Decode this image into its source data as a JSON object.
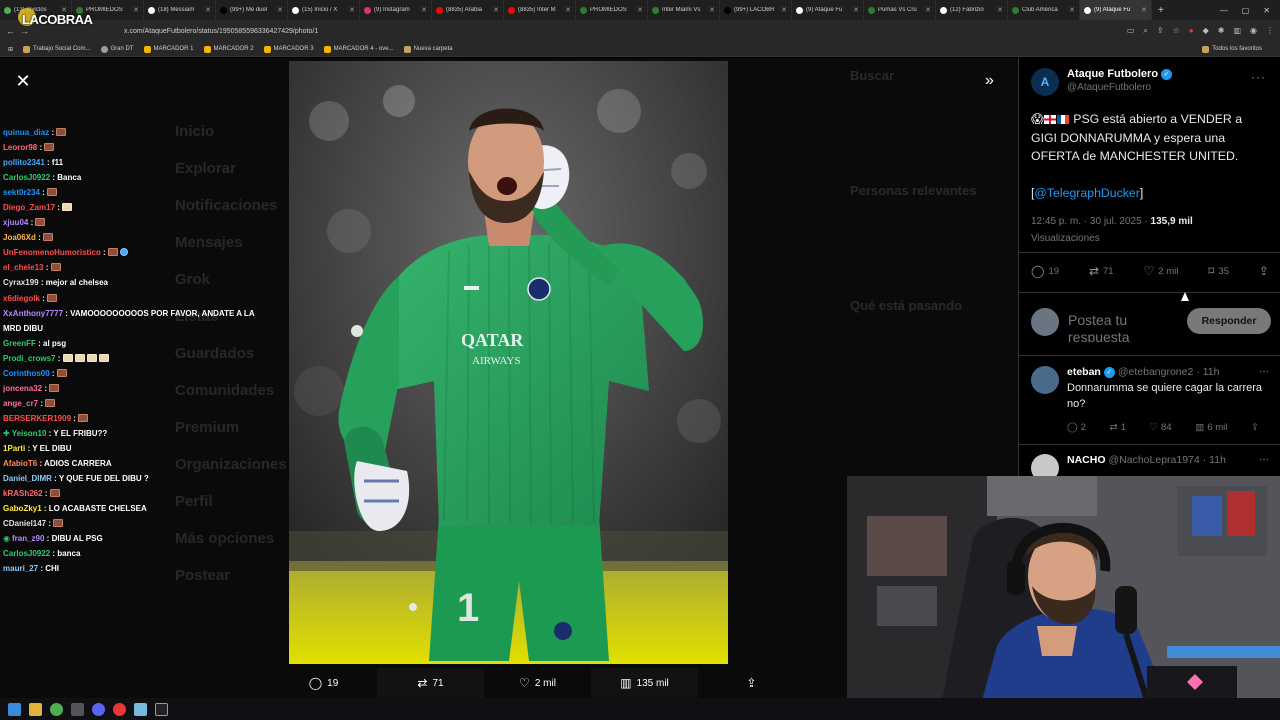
{
  "browser": {
    "tabs": [
      {
        "label": "(13) Invictos",
        "color": "#4caf50"
      },
      {
        "label": "PROMIEDOS",
        "color": "#2e7d32"
      },
      {
        "label": "(18) Messiam",
        "color": "#ffffff"
      },
      {
        "label": "(99+) Me duel",
        "color": "#000000"
      },
      {
        "label": "(15) Inicio / X",
        "color": "#ffffff"
      },
      {
        "label": "(9) Instagram",
        "color": "#e1306c"
      },
      {
        "label": "(8835) Arabia",
        "color": "#ff0000"
      },
      {
        "label": "(8835) Inter M",
        "color": "#ff0000"
      },
      {
        "label": "PROMIEDOS",
        "color": "#2e7d32"
      },
      {
        "label": "Inter Miami Vs",
        "color": "#2e7d32"
      },
      {
        "label": "(99+) LACOBR",
        "color": "#000000"
      },
      {
        "label": "(9) Ataque Fu",
        "color": "#ffffff"
      },
      {
        "label": "Pumas Vs Cru",
        "color": "#2e7d32"
      },
      {
        "label": "(12) Fabrizio",
        "color": "#ffffff"
      },
      {
        "label": "Club América",
        "color": "#2e7d32"
      },
      {
        "label": "(9) Ataque Fu",
        "color": "#ffffff",
        "active": true
      }
    ],
    "url": "x.com/AtaqueFutbolero/status/1950585596336427429/photo/1",
    "bookmarks": [
      {
        "label": "Trabajo Social Com...",
        "type": "folder"
      },
      {
        "label": "Gran DT",
        "type": "grey"
      },
      {
        "label": "MARCADOR 1",
        "type": "star"
      },
      {
        "label": "MARCADOR 2",
        "type": "star"
      },
      {
        "label": "MARCADOR 3",
        "type": "star"
      },
      {
        "label": "MARCADOR 4 - ove...",
        "type": "star"
      },
      {
        "label": "Nueva carpeta",
        "type": "folder"
      }
    ],
    "all_bookmarks_label": "Todos los favoritos"
  },
  "overlay": {
    "logo": "LACOBRAA"
  },
  "chat": [
    {
      "user": "quinua_diaz",
      "color": "#1e90ff",
      "msg": "",
      "emotes": [
        "brick"
      ]
    },
    {
      "user": "Leoror98",
      "color": "#ff6b6b",
      "msg": "",
      "emotes": [
        "brick"
      ]
    },
    {
      "user": "pollito2341",
      "color": "#3fa9ff",
      "msg": "f11",
      "emotes": []
    },
    {
      "user": "CarlosJ0922",
      "color": "#2ecc71",
      "msg": "Banca",
      "emotes": []
    },
    {
      "user": "sekt0r234",
      "color": "#1e90ff",
      "msg": "",
      "emotes": [
        "brick"
      ]
    },
    {
      "user": "Diego_Zam17",
      "color": "#ff4d4d",
      "msg": "",
      "emotes": [
        "brick-light"
      ]
    },
    {
      "user": "xjuu04",
      "color": "#b388ff",
      "msg": "",
      "emotes": [
        "brick"
      ]
    },
    {
      "user": "Joa06Xd",
      "color": "#ffb74d",
      "msg": "",
      "emotes": [
        "brick"
      ]
    },
    {
      "user": "UnFenomenoHumoristico",
      "color": "#ff4d4d",
      "msg": "",
      "emotes": [
        "brick",
        "bird"
      ]
    },
    {
      "user": "el_chele13",
      "color": "#ff4d4d",
      "msg": "",
      "emotes": [
        "brick"
      ]
    },
    {
      "user": "Cyrax199",
      "color": "#e0e0e0",
      "msg": "mejor al chelsea",
      "emotes": []
    },
    {
      "user": "x6diegolk",
      "color": "#ff4d4d",
      "msg": "",
      "emotes": [
        "brick"
      ]
    },
    {
      "user": "XxAnthony7777",
      "color": "#b388ff",
      "msg": "VAMOOOOOOOOOS POR FAVOR, ANDATE A LA MRD DIBU",
      "emotes": [],
      "wrap": true
    },
    {
      "user": "GreenFF",
      "color": "#2ecc71",
      "msg": "al psg",
      "emotes": []
    },
    {
      "user": "Prodi_crows7",
      "color": "#2ecc71",
      "msg": "",
      "emotes": [
        "light",
        "light",
        "light",
        "light"
      ]
    },
    {
      "user": "Corinthos00",
      "color": "#1e90ff",
      "msg": "",
      "emotes": [
        "brick"
      ]
    },
    {
      "user": "joncena32",
      "color": "#ff6b9d",
      "msg": "",
      "emotes": [
        "brick"
      ]
    },
    {
      "user": "ange_cr7",
      "color": "#ff6b9d",
      "msg": "",
      "emotes": [
        "brick"
      ]
    },
    {
      "user": "BERSERKER1909",
      "color": "#ff4d4d",
      "msg": "",
      "emotes": [
        "brick"
      ]
    },
    {
      "user": "Yeison10",
      "color": "#2ecc71",
      "msg": "Y EL FRIBU??",
      "emotes": [],
      "badge": "+"
    },
    {
      "user": "1Parti",
      "color": "#ffeb3b",
      "msg": "Y EL DIBU",
      "emotes": []
    },
    {
      "user": "AfabioT6",
      "color": "#ff8a65",
      "msg": "ADIOS CARRERA",
      "emotes": []
    },
    {
      "user": "Daniel_DIMR",
      "color": "#90caf9",
      "msg": "Y QUE FUE DEL DIBU ?",
      "emotes": []
    },
    {
      "user": "kRASh262",
      "color": "#ff6b6b",
      "msg": "",
      "emotes": [
        "brick"
      ]
    },
    {
      "user": "GaboZky1",
      "color": "#ffeb3b",
      "msg": "LO ACABASTE CHELSEA",
      "emotes": []
    },
    {
      "user": "CDaniel147",
      "color": "#e0e0e0",
      "msg": "",
      "emotes": [
        "brick"
      ]
    },
    {
      "user": "fran_z90",
      "color": "#b388ff",
      "msg": "DIBU AL PSG",
      "emotes": [],
      "badge": "AB"
    },
    {
      "user": "CarlosJ0922",
      "color": "#2ecc71",
      "msg": "banca",
      "emotes": []
    },
    {
      "user": "mauri_27",
      "color": "#90caf9",
      "msg": "CHI",
      "emotes": []
    }
  ],
  "ghost": {
    "nav": [
      "Inicio",
      "Explorar",
      "Notificaciones",
      "Mensajes",
      "Grok",
      "Listas",
      "Guardados",
      "Comunidades",
      "Premium",
      "Organizaciones",
      "Perfil",
      "Más opciones",
      "Postear"
    ],
    "right": [
      "Buscar",
      "Personas relevantes",
      "Qué está pasando"
    ]
  },
  "photo_actions": {
    "replies": "19",
    "reposts": "71",
    "likes": "2 mil",
    "views": "135 mil"
  },
  "tweet": {
    "display_name": "Ataque Futbolero",
    "handle": "@AtaqueFutbolero",
    "avatar_letter": "A",
    "text_main": "PSG está abierto a VENDER a GIGI DONNARUMMA y espera una OFERTA de MANCHESTER UNITED.",
    "text_source": "@TelegraphDucker",
    "time": "12:45 p. m. · 30 jul. 2025 · ",
    "views_count": "135,9 mil",
    "views_label": "Visualizaciones",
    "stats": {
      "replies": "19",
      "reposts": "71",
      "likes": "2 mil",
      "bookmarks": "35"
    },
    "reply_placeholder": "Postea tu respuesta",
    "reply_button": "Responder"
  },
  "comments": [
    {
      "name": "eteban",
      "handle": "@etebangrone2",
      "time": "· 11h",
      "text": "Donnarumma se quiere cagar la carrera no?",
      "replies": "2",
      "reposts": "1",
      "likes": "84",
      "views": "6 mil"
    },
    {
      "name": "NACHO",
      "handle": "@NachoLepra1974",
      "time": "· 11h",
      "text": "",
      "replies": "",
      "reposts": "",
      "likes": "",
      "views": ""
    }
  ],
  "colors": {
    "accent": "#1d9bf0",
    "psg_green": "#2fa866"
  }
}
